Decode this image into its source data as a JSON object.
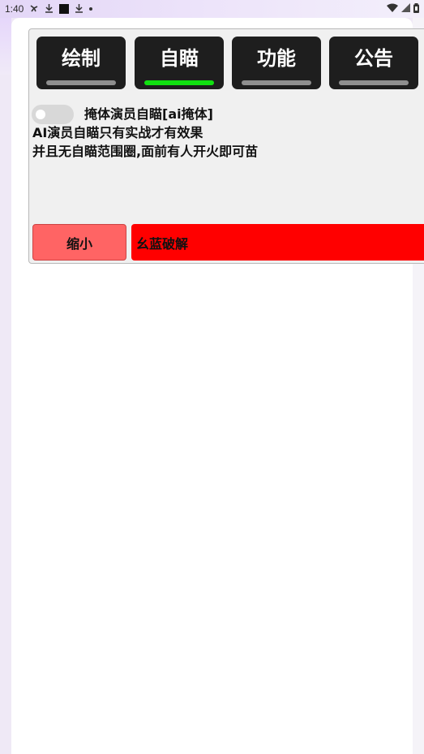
{
  "status_bar": {
    "time": "1:40",
    "left_icons": [
      "fan-icon",
      "download-icon",
      "square-app-icon",
      "download-icon",
      "dot-icon"
    ],
    "right_icons": [
      "wifi-icon",
      "signal-icon",
      "battery-icon"
    ]
  },
  "tabs": [
    {
      "label": "绘制",
      "active": false
    },
    {
      "label": "自瞄",
      "active": true
    },
    {
      "label": "功能",
      "active": false
    },
    {
      "label": "公告",
      "active": false
    }
  ],
  "option": {
    "label": "掩体演员自瞄[ai掩体]",
    "enabled": false
  },
  "description": {
    "line1": "AI演员自瞄只有实战才有效果",
    "line2": "并且无自瞄范围圈,面前有人开火即可苗"
  },
  "buttons": {
    "shrink_label": "缩小",
    "crack_label": "幺蓝破解"
  },
  "colors": {
    "active_tab_indicator": "#11e011",
    "inactive_tab_indicator": "#8f8f8f",
    "shrink_button": "#ff6464",
    "crack_button": "#ff0000"
  }
}
